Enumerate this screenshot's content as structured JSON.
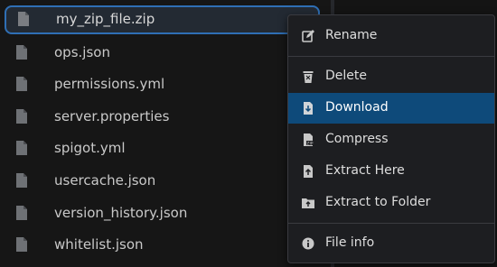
{
  "files": [
    {
      "name": "my_zip_file.zip",
      "selected": true
    },
    {
      "name": "ops.json"
    },
    {
      "name": "permissions.yml"
    },
    {
      "name": "server.properties"
    },
    {
      "name": "spigot.yml"
    },
    {
      "name": "usercache.json"
    },
    {
      "name": "version_history.json"
    },
    {
      "name": "whitelist.json"
    }
  ],
  "context_menu": {
    "items": [
      {
        "label": "Rename",
        "icon": "pencil-icon"
      },
      {
        "label": "Delete",
        "icon": "trash-icon"
      },
      {
        "label": "Download",
        "icon": "download-file-icon",
        "active": true
      },
      {
        "label": "Compress",
        "icon": "zip-file-icon"
      },
      {
        "label": "Extract Here",
        "icon": "extract-file-icon"
      },
      {
        "label": "Extract to Folder",
        "icon": "folder-upload-icon"
      },
      {
        "label": "File info",
        "icon": "info-icon"
      }
    ]
  },
  "colors": {
    "selection_border": "#2f6fb5",
    "menu_active": "#0e4a7a",
    "background": "#161616"
  }
}
